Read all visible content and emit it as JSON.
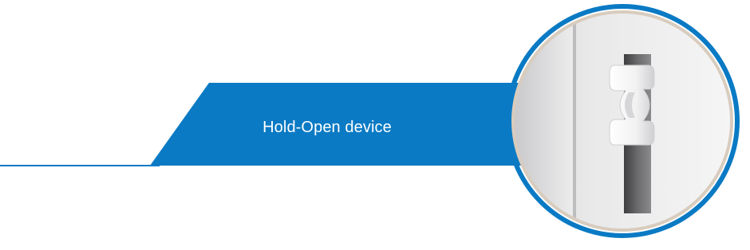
{
  "banner": {
    "label": "Hold-Open device"
  },
  "colors": {
    "accent": "#0a7ac4",
    "ring_outer": "#0a7ac4",
    "ring_inner": "#d8ccbe",
    "background": "#ffffff"
  },
  "image": {
    "subject": "hold-open-device-photo"
  }
}
